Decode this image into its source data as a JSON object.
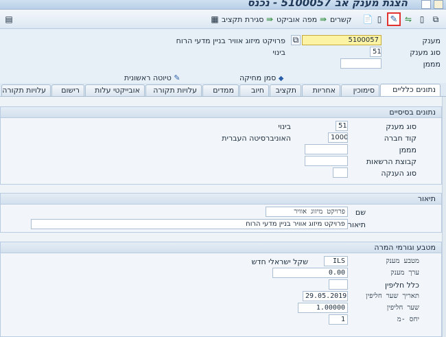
{
  "window": {
    "title": "הצגת מענק אב 5100057 - נכנס"
  },
  "toolbar": {
    "budget_closing_label": "סגירת תקציב",
    "object_map_label": "מפה אוביקט",
    "links_label": "קשרים",
    "edit_icon": "pencil-icon"
  },
  "header": {
    "grant_label": "מענק",
    "grant_value": "5100057",
    "grant_description": "פרויקט מיזוג אוויר בניין מדעי הרוח",
    "grant_type_label": "סוג מענק",
    "grant_type_value": "51",
    "grant_type_text": "בינוי",
    "sponsor_label": "מממן",
    "sponsor_value": "",
    "deletion_flag_label": "סמן מחיקה",
    "first_draft_label": "טיוטה ראשונית"
  },
  "tabs": [
    {
      "label": "נתונים כלליים",
      "active": true
    },
    {
      "label": "סימוכין"
    },
    {
      "label": "אחריות"
    },
    {
      "label": "תקציב"
    },
    {
      "label": "חיוב"
    },
    {
      "label": "ממדים"
    },
    {
      "label": "עלויות תקורה"
    },
    {
      "label": "אובייקטי עלות"
    },
    {
      "label": "רישום"
    },
    {
      "label": "עלויות תקורה"
    }
  ],
  "basic_data": {
    "title": "נתונים בסיסיים",
    "grant_type_label": "סוג מענק",
    "grant_type_value": "51",
    "grant_type_text": "בינוי",
    "company_code_label": "קוד חברה",
    "company_code_value": "1000",
    "company_code_text": "האוניברסיטה העברית",
    "sponsor_label": "מממן",
    "authority_group_label": "קבוצת הרשאות",
    "award_type_label": "סוג הענקה"
  },
  "description": {
    "title": "תיאור",
    "name_label": "שם",
    "name_value": "פרויקט מיזוג אוויר",
    "desc_label": "תיאור",
    "desc_value": "פרויקט מיזוג אוויר בניין מדעי הרוח"
  },
  "currency": {
    "title": "מטבע וגורמי המרה",
    "grant_currency_label": "מטבע מענק",
    "grant_currency_value": "ILS",
    "grant_currency_text": "שקל ישראלי חדש",
    "grant_value_label": "ערך מענק",
    "grant_value_value": "0.00",
    "exchange_rule_label": "כלל חליפין",
    "exchange_date_label": "תאריך שער חליפין",
    "exchange_date_value": "29.05.2019",
    "exchange_rate_label": "שער חליפין",
    "exchange_rate_value": "1.00000",
    "ratio_label": "יחס -מ",
    "ratio_value": "1"
  }
}
